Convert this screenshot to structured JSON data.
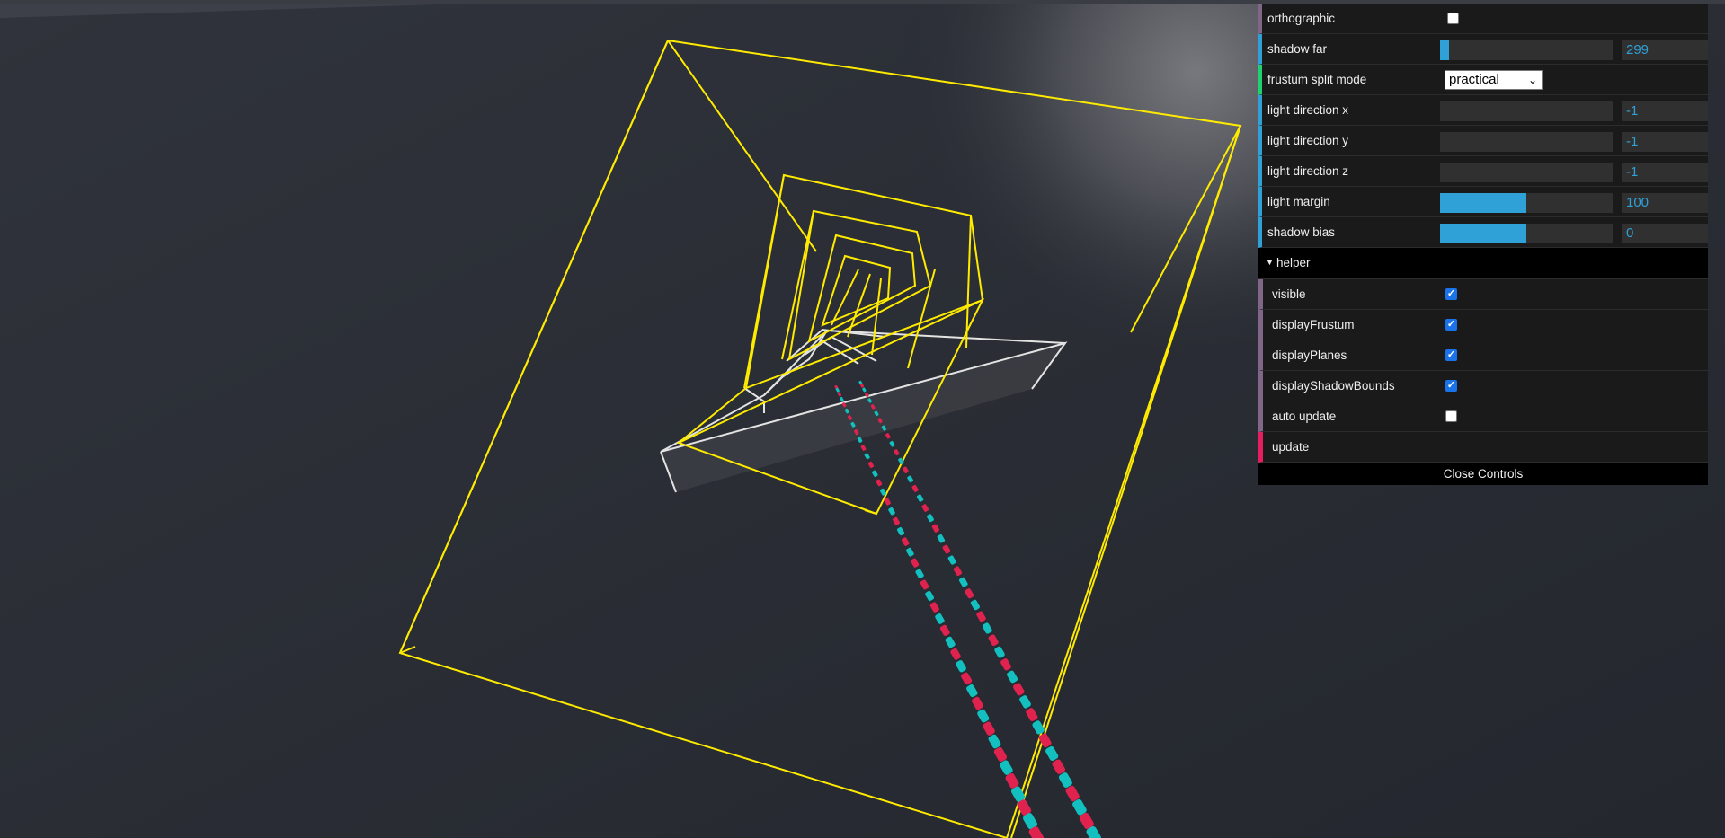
{
  "gui": {
    "controls": [
      {
        "id": "orthographic",
        "label": "orthographic",
        "type": "bool",
        "checked": false
      },
      {
        "id": "shadow_far",
        "label": "shadow far",
        "type": "number",
        "value": "299",
        "fill": 0.05
      },
      {
        "id": "frustum_split_mode",
        "label": "frustum split mode",
        "type": "select",
        "value": "practical"
      },
      {
        "id": "light_direction_x",
        "label": "light direction x",
        "type": "number",
        "value": "-1",
        "fill": 0
      },
      {
        "id": "light_direction_y",
        "label": "light direction y",
        "type": "number",
        "value": "-1",
        "fill": 0
      },
      {
        "id": "light_direction_z",
        "label": "light direction z",
        "type": "number",
        "value": "-1",
        "fill": 0
      },
      {
        "id": "light_margin",
        "label": "light margin",
        "type": "number",
        "value": "100",
        "fill": 0.5
      },
      {
        "id": "shadow_bias",
        "label": "shadow bias",
        "type": "number",
        "value": "0",
        "fill": 0.5
      }
    ],
    "helper_folder": {
      "title": "helper",
      "controls": [
        {
          "id": "visible",
          "label": "visible",
          "type": "bool",
          "checked": true
        },
        {
          "id": "display_frustum",
          "label": "displayFrustum",
          "type": "bool",
          "checked": true
        },
        {
          "id": "display_planes",
          "label": "displayPlanes",
          "type": "bool",
          "checked": true
        },
        {
          "id": "display_shadow_bounds",
          "label": "displayShadowBounds",
          "type": "bool",
          "checked": true
        },
        {
          "id": "auto_update",
          "label": "auto update",
          "type": "bool",
          "checked": false
        },
        {
          "id": "update",
          "label": "update",
          "type": "func"
        }
      ]
    },
    "close_label": "Close Controls"
  },
  "scene": {
    "frustum_color": "#ffeb00",
    "ground_outline_color": "#e0e0e0",
    "red_object_color": "#e0224f",
    "teal_object_color": "#14bfbf",
    "light_glow_color": "#7a7a7f"
  }
}
